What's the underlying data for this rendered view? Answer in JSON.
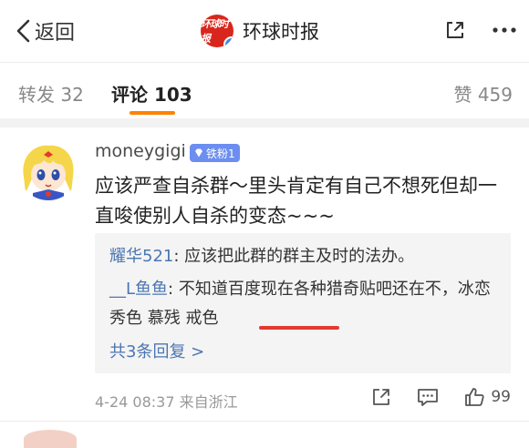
{
  "header": {
    "back_label": "返回",
    "logo_text": "环球时报",
    "title": "环球时报"
  },
  "tabs": {
    "repost": "转发 32",
    "comment": "评论 103",
    "like": "赞 459"
  },
  "comment": {
    "username": "moneygigi",
    "fan_badge": "铁粉1",
    "text": "应该严查自杀群～里头肯定有自己不想死但却一直唆使别人自杀的变态~~~",
    "replies": [
      {
        "user": "耀华521",
        "text": ": 应该把此群的群主及时的法办。"
      },
      {
        "user": "__L鱼鱼",
        "text": ": 不知道百度现在各种猎奇贴吧还在不，冰恋 秀色 慕残 戒色"
      }
    ],
    "more_replies": "共3条回复 >",
    "timestamp": "4-24 08:37",
    "location": "来自浙江",
    "like_count": "99"
  },
  "colors": {
    "accent_underline": "#ff8200",
    "link_blue": "#4b76b2",
    "brand_red": "#d9261c",
    "annotation_red": "#e23a2e"
  },
  "icons": [
    "chevron-left-icon",
    "share-icon",
    "more-icon",
    "verified-icon",
    "diamond-icon",
    "repost-icon",
    "comment-icon",
    "thumbs-up-icon"
  ]
}
